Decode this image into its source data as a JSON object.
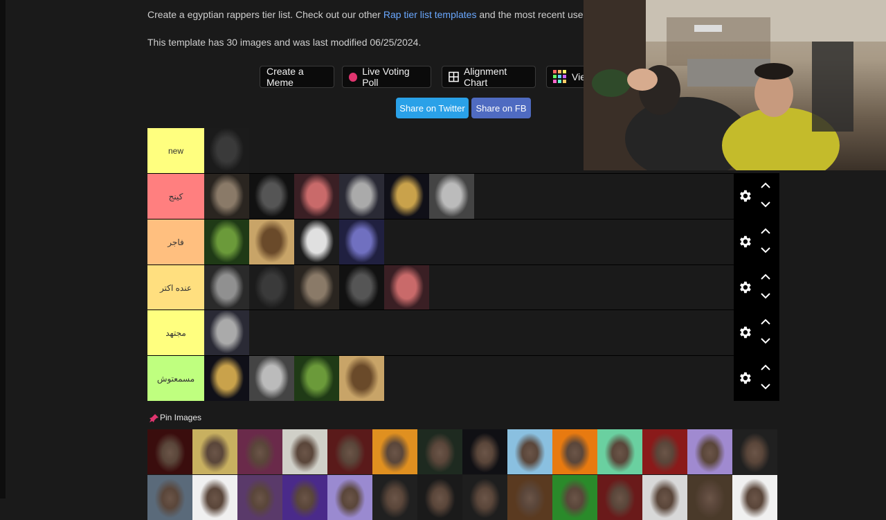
{
  "description": {
    "before_link": "Create a egyptian rappers tier list. Check out our other ",
    "link": "Rap tier list templates",
    "after_link": " and the most recent user",
    "meta": "This template has 30 images and was last modified 06/25/2024."
  },
  "buttons": {
    "create_meme": "Create a Meme",
    "live_poll": "Live Voting Poll",
    "alignment": "Alignment Chart",
    "view": "Vie"
  },
  "share": {
    "twitter": "Share on Twitter",
    "fb": "Share on FB"
  },
  "tiers": [
    {
      "label": "new",
      "color": "#ffff7f",
      "count": 1
    },
    {
      "label": "كينج",
      "color": "#ff7f7f",
      "count": 6
    },
    {
      "label": "فاجر",
      "color": "#ffbf7f",
      "count": 4
    },
    {
      "label": "عنده اكتر",
      "color": "#ffdf7f",
      "count": 5
    },
    {
      "label": "مجتهد",
      "color": "#ffff7f",
      "count": 1
    },
    {
      "label": "مسمعتوش",
      "color": "#bfff7f",
      "count": 4
    }
  ],
  "pin_images": {
    "label": "Pin Images"
  },
  "colors": {
    "link": "#6aa8ff",
    "twitter": "#2aa1e8",
    "fb": "#4f6bc1",
    "live_dot": "#e0356f"
  },
  "icons": [
    "settings-gear-icon",
    "chevron-up-icon",
    "chevron-down-icon",
    "pushpin-icon",
    "grid-icon",
    "color-grid-icon"
  ]
}
